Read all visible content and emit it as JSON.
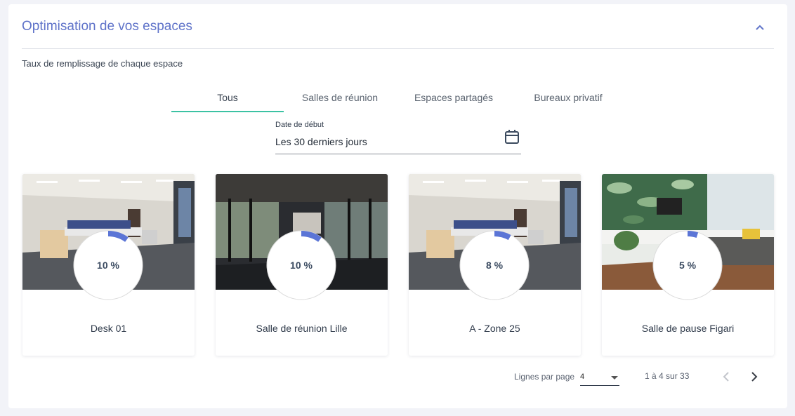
{
  "panel": {
    "title": "Optimisation de vos espaces",
    "subtitle": "Taux de remplissage de chaque espace",
    "collapse_icon": "chevron-up-icon"
  },
  "tabs": [
    {
      "label": "Tous",
      "active": true
    },
    {
      "label": "Salles de réunion",
      "active": false
    },
    {
      "label": "Espaces partagés",
      "active": false
    },
    {
      "label": "Bureaux privatif",
      "active": false
    }
  ],
  "date_field": {
    "label": "Date de début",
    "value": "Les 30 derniers jours",
    "icon": "calendar-icon"
  },
  "colors": {
    "accent": "#5f73c9",
    "tab_indicator": "#3cc2a3",
    "gauge_fill": "#5b75d6",
    "gauge_track": "#ffffff"
  },
  "cards": [
    {
      "name": "Desk 01",
      "rate_label": "10 %",
      "rate": 10,
      "photo": "open-office-photo"
    },
    {
      "name": "Salle de réunion Lille",
      "rate_label": "10 %",
      "rate": 10,
      "photo": "glass-hall-photo"
    },
    {
      "name": "A - Zone 25",
      "rate_label": "8 %",
      "rate": 8,
      "photo": "open-office-photo"
    },
    {
      "name": "Salle de pause Figari",
      "rate_label": "5 %",
      "rate": 5,
      "photo": "lounge-photo"
    }
  ],
  "pagination": {
    "rows_label": "Lignes par page",
    "rows_value": "4",
    "range_text": "1 à 4 sur 33",
    "prev_icon": "chevron-left-icon",
    "next_icon": "chevron-right-icon"
  }
}
